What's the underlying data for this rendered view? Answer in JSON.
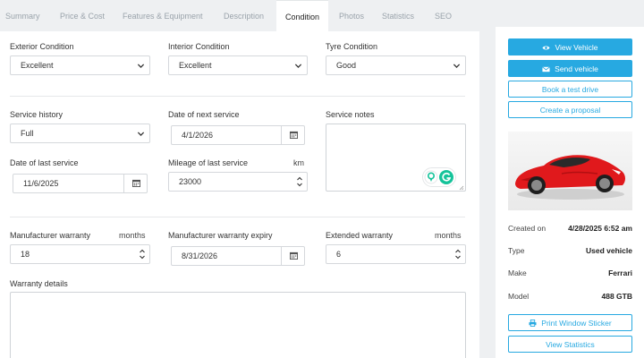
{
  "tabs": [
    {
      "label": "Summary"
    },
    {
      "label": "Price & Cost"
    },
    {
      "label": "Features & Equipment"
    },
    {
      "label": "Description"
    },
    {
      "label": "Condition",
      "active": true
    },
    {
      "label": "Photos"
    },
    {
      "label": "Statistics"
    },
    {
      "label": "SEO"
    }
  ],
  "condition": {
    "exterior": {
      "label": "Exterior Condition",
      "value": "Excellent"
    },
    "interior": {
      "label": "Interior Condition",
      "value": "Excellent"
    },
    "tyre": {
      "label": "Tyre Condition",
      "value": "Good"
    }
  },
  "service": {
    "history": {
      "label": "Service history",
      "value": "Full"
    },
    "next_date": {
      "label": "Date of next service",
      "value": "4/1/2026"
    },
    "notes": {
      "label": "Service notes",
      "value": ""
    },
    "last_date": {
      "label": "Date of last service",
      "value": "11/6/2025"
    },
    "mileage": {
      "label": "Mileage of last service",
      "unit": "km",
      "value": "23000"
    }
  },
  "warranty": {
    "manufacturer": {
      "label": "Manufacturer warranty",
      "unit": "months",
      "value": "18"
    },
    "expiry": {
      "label": "Manufacturer warranty expiry",
      "value": "8/31/2026"
    },
    "extended": {
      "label": "Extended warranty",
      "unit": "months",
      "value": "6"
    },
    "details": {
      "label": "Warranty details",
      "value": ""
    }
  },
  "sidebar": {
    "view_vehicle": "View Vehicle",
    "send_vehicle": "Send vehicle",
    "book_test_drive": "Book a test drive",
    "create_proposal": "Create a proposal",
    "created_on": {
      "label": "Created on",
      "value": "4/28/2025 6:52 am"
    },
    "type": {
      "label": "Type",
      "value": "Used vehicle"
    },
    "make": {
      "label": "Make",
      "value": "Ferrari"
    },
    "model": {
      "label": "Model",
      "value": "488 GTB"
    },
    "print_sticker": "Print Window Sticker",
    "view_statistics": "View Statistics"
  },
  "colors": {
    "accent": "#27a9e1",
    "grammarly": "#15c39a",
    "car": "#e0191c"
  },
  "icons": [
    "eye-icon",
    "envelope-icon",
    "calendar-icon",
    "chevron-down-icon",
    "spinner-icon",
    "print-icon",
    "grammarly-icon"
  ]
}
